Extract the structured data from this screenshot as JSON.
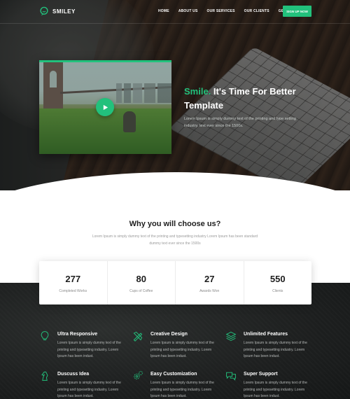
{
  "colors": {
    "accent": "#22c17c",
    "dark_bg": "#1d1f1f",
    "text_dark": "#1d1d1d",
    "muted": "#9a9a9a"
  },
  "header": {
    "logo_icon": "smile-chat-icon",
    "logo_text": "SMILEY",
    "nav": [
      "HOME",
      "ABOUT US",
      "OUR SERVICES",
      "OUR CLIENTS",
      "GET IT NOW"
    ],
    "cta": "SIGN UP NOW"
  },
  "hero": {
    "video_icon": "play-icon",
    "title_accent": "Smile.",
    "title_rest": "It's Time For Better",
    "title_line2": "Template",
    "description": "Lorem Ipsum is simply dummy text of the printing and type setting industry. text ever since the 1500s."
  },
  "why": {
    "title": "Why you will choose us?",
    "description": "Lorem Ipsum is simply dummy text of the printing and typesetting industry Lorem Ipsum has been standard dummy text ever since the 1500s"
  },
  "stats": [
    {
      "value": "277",
      "label": "Completed Works"
    },
    {
      "value": "80",
      "label": "Cups of Coffee"
    },
    {
      "value": "27",
      "label": "Awards Won"
    },
    {
      "value": "550",
      "label": "Clients"
    }
  ],
  "features": [
    {
      "icon": "lightbulb-icon",
      "title": "Ultra Responsive",
      "desc": "Lorem Ipsum is simply dummy text of the printing and typesetting industry. Lorem Ipsum has been indust."
    },
    {
      "icon": "design-tools-icon",
      "title": "Creative Design",
      "desc": "Lorem Ipsum is simply dummy text of the printing and typesetting industry. Lorem Ipsum has been indust."
    },
    {
      "icon": "layers-icon",
      "title": "Unlimited Features",
      "desc": "Lorem Ipsum is simply dummy text of the printing and typesetting industry. Lorem Ipsum has been indust."
    },
    {
      "icon": "chess-knight-icon",
      "title": "Duscuss Idea",
      "desc": "Lorem Ipsum is simply dummy text of the printing and typesetting industry. Lorem Ipsum has been indust."
    },
    {
      "icon": "gears-icon",
      "title": "Easy Customization",
      "desc": "Lorem Ipsum is simply dummy text of the printing and typesetting industry. Lorem Ipsum has been indust."
    },
    {
      "icon": "chat-bubbles-icon",
      "title": "Super Support",
      "desc": "Lorem Ipsum is simply dummy text of the printing and typesetting industry. Lorem Ipsum has been indust."
    }
  ]
}
